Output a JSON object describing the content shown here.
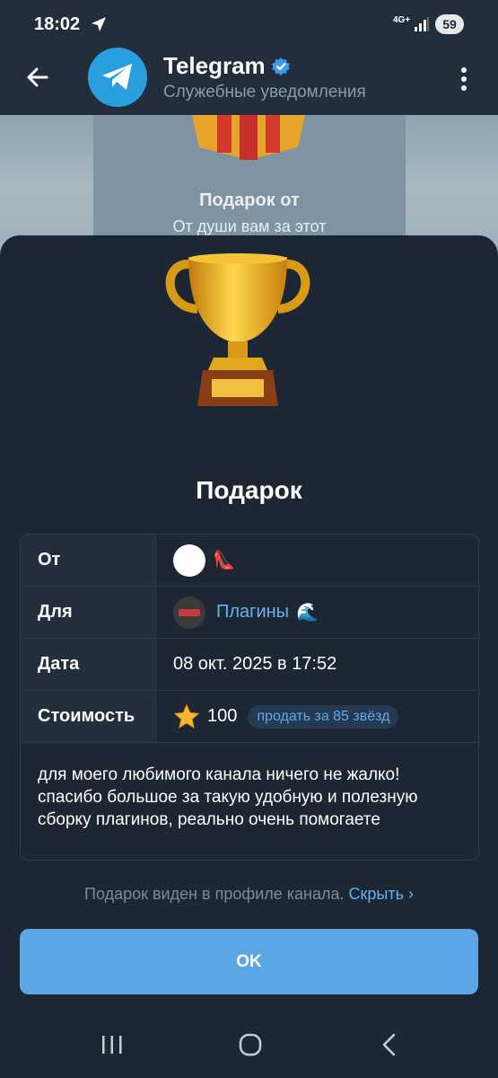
{
  "status_bar": {
    "time": "18:02",
    "network": "4G+",
    "battery": "59"
  },
  "header": {
    "title": "Telegram",
    "subtitle": "Служебные уведомления"
  },
  "background_message": {
    "gift_title": "Подарок от",
    "gift_text": "От души вам за этот"
  },
  "sheet": {
    "title": "Подарок",
    "rows": {
      "from": {
        "label": "От",
        "emoji": "👠"
      },
      "to": {
        "label": "Для",
        "channel": "Плагины",
        "emoji": "🌊"
      },
      "date": {
        "label": "Дата",
        "value": "08 окт. 2025 в 17:52"
      },
      "cost": {
        "label": "Стоимость",
        "value": "100",
        "sell_label": "продать за 85 звёзд"
      }
    },
    "comment": "для моего любимого канала ничего не жалко! спасибо большое за такую удобную и полезную сборку плагинов, реально очень помогаете",
    "visibility_text": "Подарок виден в профиле канала.",
    "hide_link": "Скрыть ›",
    "ok_label": "OK"
  },
  "icons": {
    "back": "arrow-left-icon",
    "menu": "more-vertical-icon",
    "verified": "verified-badge-icon",
    "trophy": "trophy-icon",
    "star": "star-icon"
  },
  "colors": {
    "accent": "#5ba7e6",
    "link": "#62b3f3",
    "background": "#1d2733"
  }
}
